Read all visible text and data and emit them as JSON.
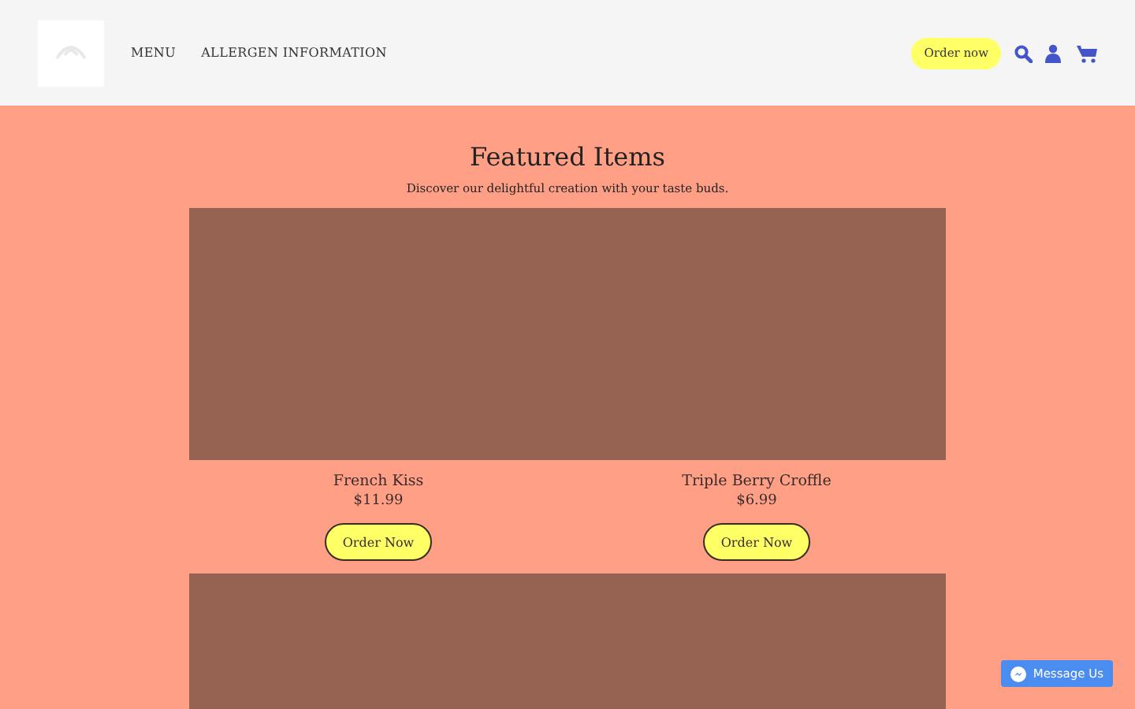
{
  "header": {
    "nav": [
      "MENU",
      "ALLERGEN INFORMATION"
    ],
    "order_button": "Order now"
  },
  "featured": {
    "title": "Featured Items",
    "subtitle": "Discover our delightful creation with your taste buds.",
    "items": [
      {
        "kind": "product",
        "name": "French Kiss",
        "price": "$11.99",
        "button": "Order Now"
      },
      {
        "kind": "product",
        "name": "Triple Berry Croffle",
        "price": "$6.99",
        "button": "Order Now"
      },
      {
        "kind": "picture"
      },
      {
        "kind": "picture"
      }
    ]
  },
  "chat_button": "Message Us"
}
